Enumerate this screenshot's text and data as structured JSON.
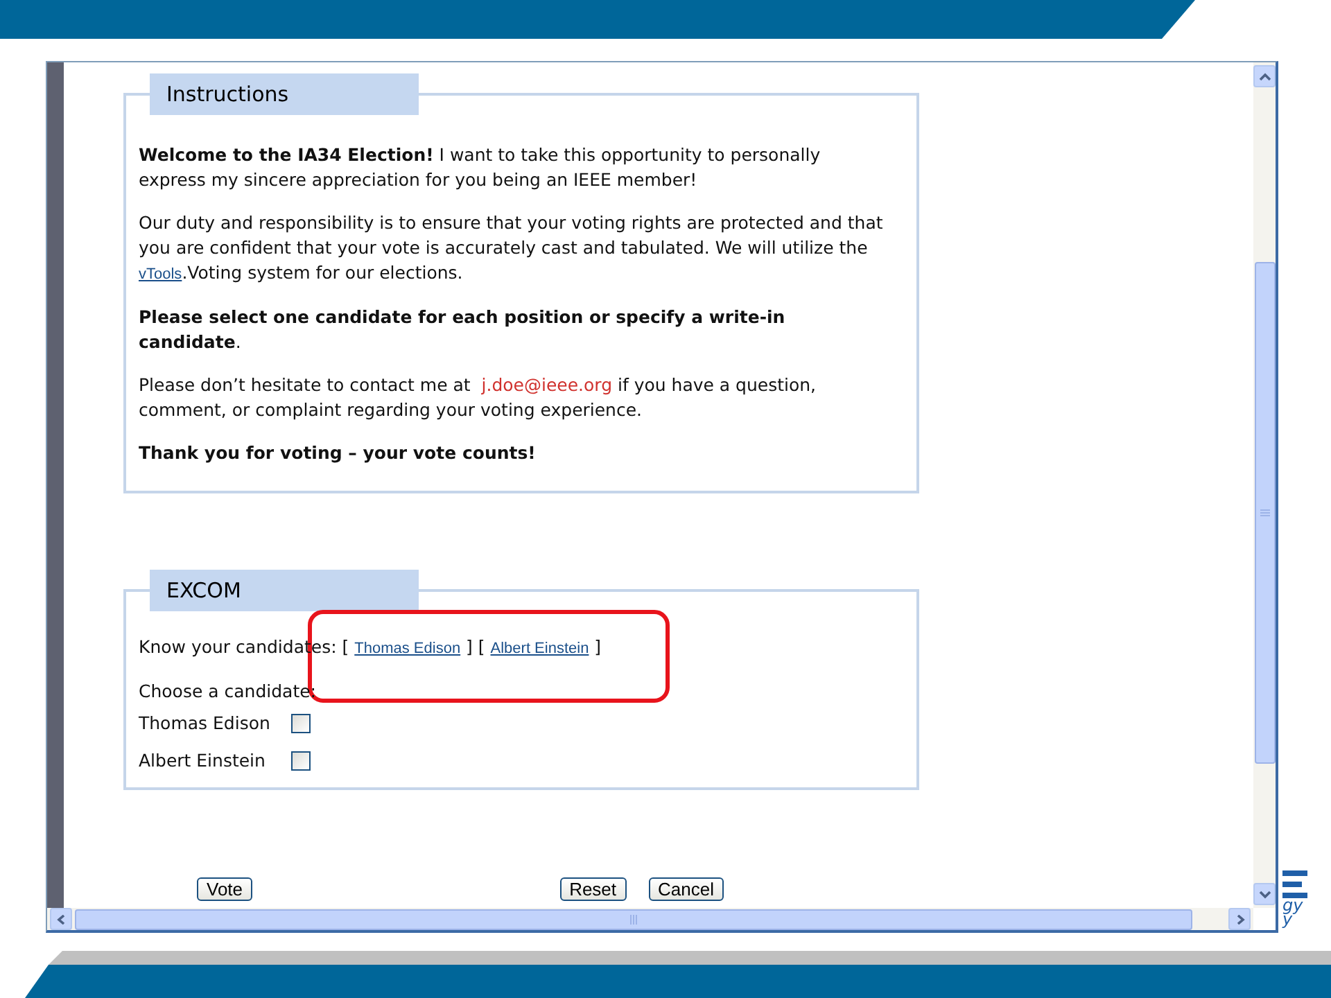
{
  "instructions": {
    "legend": "Instructions",
    "paragraphs": [
      {
        "bold": false,
        "parts": [
          {
            "kind": "text",
            "text": "**Welcome to the IA34 Election!** I want to take this opportunity to personally express my sincere appreciation for you being an IEEE member!"
          }
        ]
      },
      {
        "bold": false,
        "parts": [
          {
            "kind": "text",
            "text": "Our duty and responsibility is to ensure that your voting rights are protected and that you are confident that your vote is accurately cast and tabulated. We will utilize the "
          },
          {
            "kind": "link",
            "text": "vTools"
          },
          {
            "kind": "text",
            "text": ".Voting system for our elections."
          }
        ]
      },
      {
        "bold": false,
        "parts": [
          {
            "kind": "text",
            "text": "**Please select one candidate for each position or specify a write-in candidate**."
          }
        ]
      },
      {
        "bold": false,
        "parts": [
          {
            "kind": "text",
            "text": "Please don’t hesitate to contact me at "
          },
          {
            "kind": "email",
            "text": "j.doe@ieee.org"
          },
          {
            "kind": "text",
            "text": " if you have a question, comment, or complaint regarding your voting experience."
          }
        ]
      },
      {
        "bold": true,
        "parts": [
          {
            "kind": "text",
            "text": "Thank you for voting – your vote counts!"
          }
        ]
      }
    ]
  },
  "excom": {
    "legend": "EXCOM",
    "know_line": [
      {
        "kind": "text",
        "text": "Know your candidates: [ "
      },
      {
        "kind": "link",
        "text": "Thomas Edison"
      },
      {
        "kind": "text",
        "text": " ] [ "
      },
      {
        "kind": "link",
        "text": "Albert Einstein"
      },
      {
        "kind": "text",
        "text": " ]"
      }
    ],
    "choose_label": "Choose a candidate:",
    "candidates": [
      {
        "name": "Thomas Edison",
        "checked": false
      },
      {
        "name": "Albert Einstein",
        "checked": false
      }
    ]
  },
  "buttons": {
    "left": [
      "Vote"
    ],
    "right": [
      "Reset",
      "Cancel"
    ]
  },
  "logo_fragments": [
    "gy",
    "y"
  ]
}
